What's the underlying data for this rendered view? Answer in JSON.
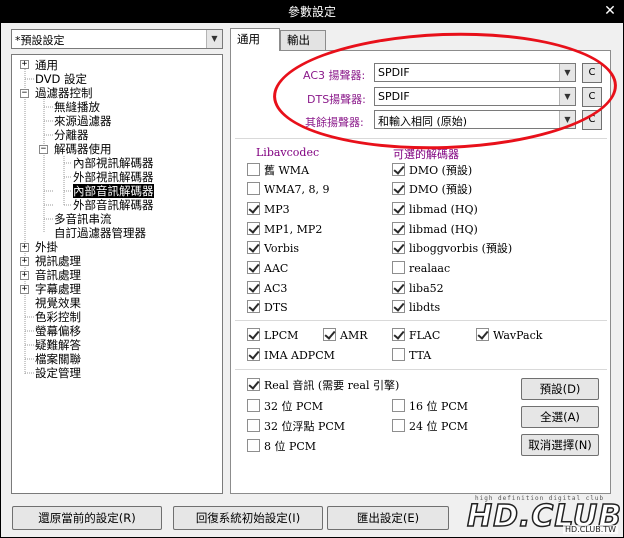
{
  "window": {
    "title": "參數設定",
    "close_glyph": "✕"
  },
  "preset": {
    "value": "*預設設定",
    "arrow": "▼"
  },
  "tree": {
    "items": [
      {
        "label": "通用",
        "expander": "+"
      },
      {
        "label": "DVD 設定"
      },
      {
        "label": "過濾器控制",
        "expander": "−"
      },
      {
        "label": "無縫播放"
      },
      {
        "label": "來源過濾器"
      },
      {
        "label": "分離器"
      },
      {
        "label": "解碼器使用",
        "expander": "−"
      },
      {
        "label": "內部視訊解碼器"
      },
      {
        "label": "外部視訊解碼器"
      },
      {
        "label": "內部音訊解碼器"
      },
      {
        "label": "外部音訊解碼器"
      },
      {
        "label": "多音訊串流"
      },
      {
        "label": "自訂過濾器管理器"
      },
      {
        "label": "外掛",
        "expander": "+"
      },
      {
        "label": "視訊處理",
        "expander": "+"
      },
      {
        "label": "音訊處理",
        "expander": "+"
      },
      {
        "label": "字幕處理",
        "expander": "+"
      },
      {
        "label": "視覺效果"
      },
      {
        "label": "色彩控制"
      },
      {
        "label": "螢幕偏移"
      },
      {
        "label": "疑難解答"
      },
      {
        "label": "檔案關聯"
      },
      {
        "label": "設定管理"
      }
    ]
  },
  "tabs": [
    {
      "label": "通用"
    },
    {
      "label": "輸出"
    }
  ],
  "speakers": {
    "ac3_label": "AC3 揚聲器:",
    "ac3_value": "SPDIF",
    "dts_label": "DTS揚聲器:",
    "dts_value": "SPDIF",
    "other_label": "其餘揚聲器:",
    "other_value": "和輸入相同 (原始)",
    "button_glyph": "C",
    "arrow": "▼"
  },
  "libavcodec": {
    "title": "Libavcodec",
    "items": [
      {
        "label": "舊 WMA",
        "checked": false
      },
      {
        "label": "WMA7, 8, 9",
        "checked": false
      },
      {
        "label": "MP3",
        "checked": true
      },
      {
        "label": "MP1, MP2",
        "checked": true
      },
      {
        "label": "Vorbis",
        "checked": true
      },
      {
        "label": "AAC",
        "checked": true
      },
      {
        "label": "AC3",
        "checked": true
      },
      {
        "label": "DTS",
        "checked": true
      }
    ]
  },
  "alt_decoders": {
    "title": "可選的解碼器",
    "items": [
      {
        "label": "DMO (預設)",
        "checked": true
      },
      {
        "label": "DMO (預設)",
        "checked": true
      },
      {
        "label": "libmad (HQ)",
        "checked": true
      },
      {
        "label": "libmad (HQ)",
        "checked": true
      },
      {
        "label": "liboggvorbis (預設)",
        "checked": true
      },
      {
        "label": "realaac",
        "checked": false
      },
      {
        "label": "liba52",
        "checked": true
      },
      {
        "label": "libdts",
        "checked": true
      }
    ]
  },
  "formats": [
    {
      "label": "LPCM",
      "checked": true
    },
    {
      "label": "AMR",
      "checked": true
    },
    {
      "label": "FLAC",
      "checked": true
    },
    {
      "label": "WavPack",
      "checked": true
    },
    {
      "label": "IMA ADPCM",
      "checked": true
    },
    {
      "label": "TTA",
      "checked": false
    }
  ],
  "output_opts": [
    {
      "label": "Real 音訊 (需要 real 引擎)",
      "checked": true
    },
    {
      "label": "32 位 PCM",
      "checked": false
    },
    {
      "label": "16 位 PCM",
      "checked": false
    },
    {
      "label": "32 位浮點 PCM",
      "checked": false
    },
    {
      "label": "24 位 PCM",
      "checked": false
    },
    {
      "label": "8 位 PCM",
      "checked": false
    }
  ],
  "side_buttons": {
    "default": "預設(D)",
    "select_all": "全選(A)",
    "deselect": "取消選擇(N)"
  },
  "bottom_buttons": {
    "restore": "還原當前的設定(R)",
    "reset": "回復系統初始設定(I)",
    "export": "匯出設定(E)"
  },
  "watermark": {
    "big": "HD.CLUB",
    "small": "HD.CLUB.TW",
    "top": "high definition digital club"
  }
}
